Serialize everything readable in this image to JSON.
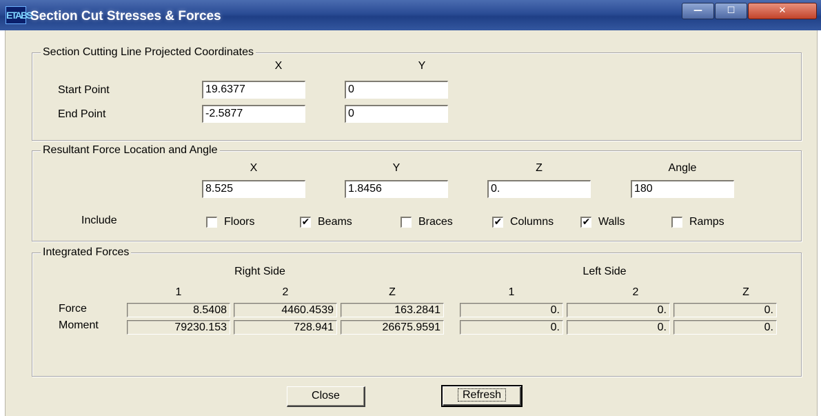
{
  "window": {
    "title": "Section Cut Stresses & Forces",
    "icon_text": "ETABS",
    "minimize": "—",
    "maximize": "☐",
    "close": "✕"
  },
  "section_cutting": {
    "title": "Section Cutting Line Projected Coordinates",
    "x_header": "X",
    "y_header": "Y",
    "start_label": "Start Point",
    "start_x": "19.6377",
    "start_y": "0",
    "end_label": "End Point",
    "end_x": "-2.5877",
    "end_y": "0"
  },
  "resultant": {
    "title": "Resultant Force Location and Angle",
    "x_header": "X",
    "y_header": "Y",
    "z_header": "Z",
    "angle_header": "Angle",
    "x": "8.525",
    "y": "1.8456",
    "z": "0.",
    "angle": "180",
    "include_label": "Include",
    "include": [
      {
        "label": "Floors",
        "checked": false,
        "mark": ""
      },
      {
        "label": "Beams",
        "checked": true,
        "mark": "✔"
      },
      {
        "label": "Braces",
        "checked": false,
        "mark": ""
      },
      {
        "label": "Columns",
        "checked": true,
        "mark": "✔"
      },
      {
        "label": "Walls",
        "checked": true,
        "mark": "✔"
      },
      {
        "label": "Ramps",
        "checked": false,
        "mark": ""
      }
    ]
  },
  "integrated": {
    "title": "Integrated Forces",
    "right_side": "Right Side",
    "left_side": "Left Side",
    "col_headers": [
      "1",
      "2",
      "Z",
      "1",
      "2",
      "Z"
    ],
    "force_label": "Force",
    "moment_label": "Moment",
    "force": [
      "8.5408",
      "4460.4539",
      "163.2841",
      "0.",
      "0.",
      "0."
    ],
    "moment": [
      "79230.153",
      "728.941",
      "26675.9591",
      "0.",
      "0.",
      "0."
    ]
  },
  "buttons": {
    "close": "Close",
    "refresh": "Refresh"
  }
}
